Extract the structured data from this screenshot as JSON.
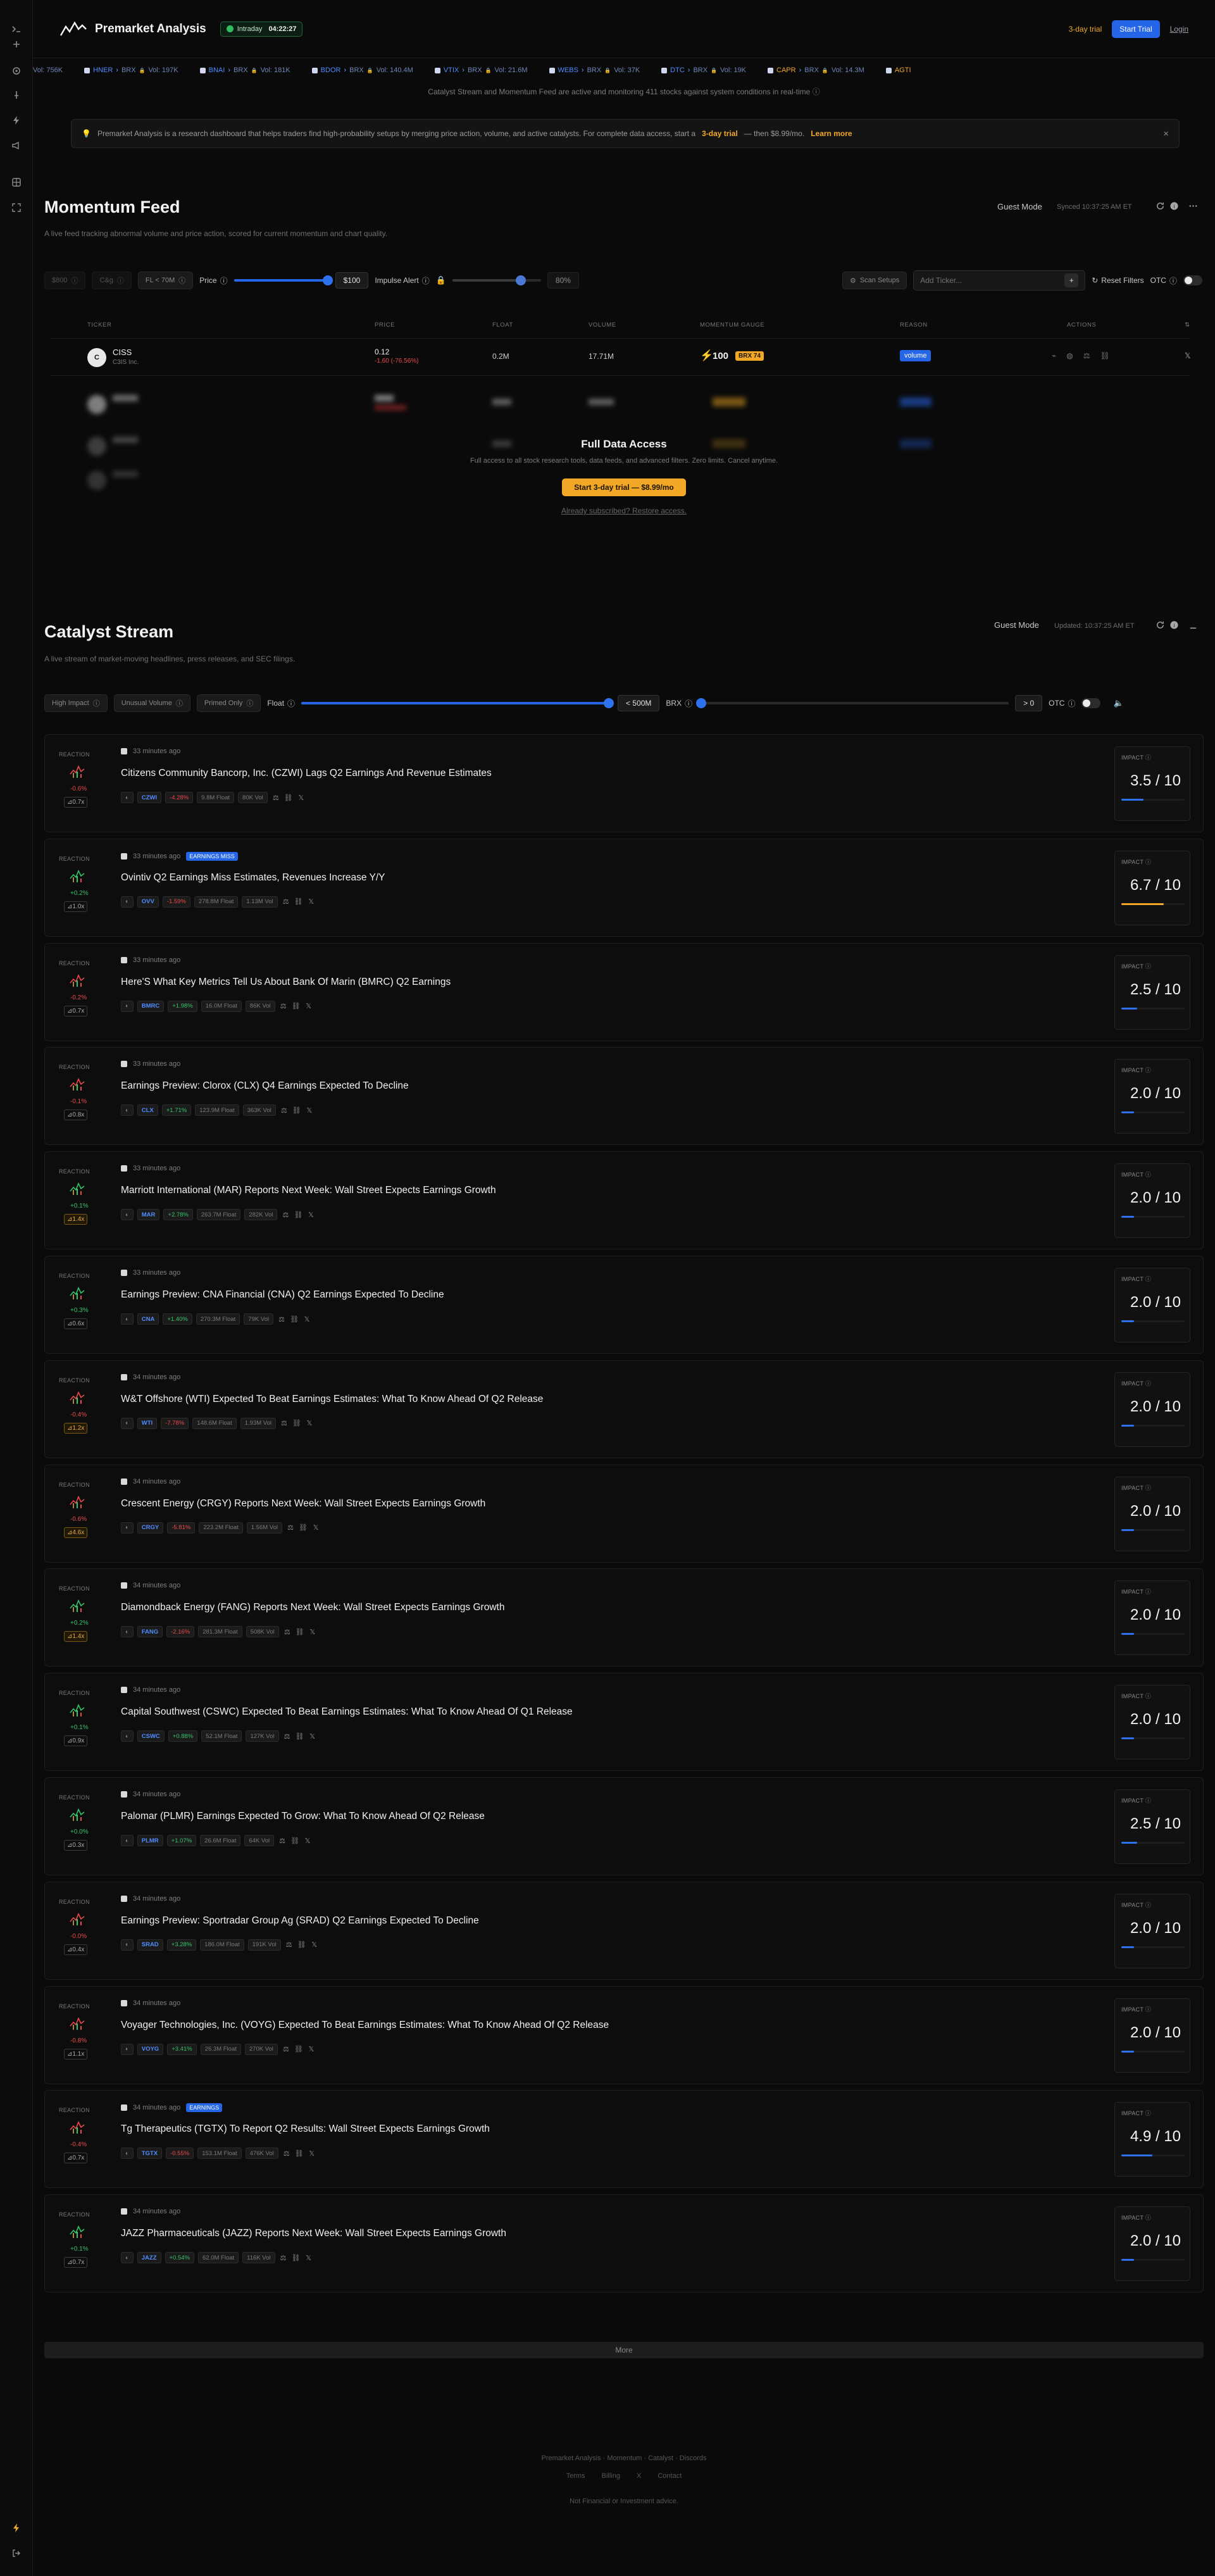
{
  "app": {
    "name": "Premarket Analysis"
  },
  "market_status": {
    "label": "Intraday",
    "time": "04:22:27"
  },
  "header": {
    "trial_text": "3-day trial",
    "start_trial": "Start Trial",
    "login": "Login"
  },
  "ticker_tape": [
    {
      "symbol": "",
      "text": "Vol: 756K"
    },
    {
      "symbol": "HNER",
      "text": "BRX",
      "vol": "Vol: 197K"
    },
    {
      "symbol": "BNAI",
      "text": "BRX",
      "vol": "Vol: 181K"
    },
    {
      "symbol": "BDOR",
      "text": "BRX",
      "vol": "Vol: 140.4M"
    },
    {
      "symbol": "VTIX",
      "text": "BRX",
      "vol": "Vol: 21.6M"
    },
    {
      "symbol": "WEBS",
      "text": "BRX",
      "vol": "Vol: 37K"
    },
    {
      "symbol": "DTC",
      "text": "BRX",
      "vol": "Vol: 19K"
    },
    {
      "symbol": "CAPR",
      "text": "BRX",
      "vol": "Vol: 14.3M",
      "orange": true
    },
    {
      "symbol": "AGTI",
      "text": "",
      "vol": "",
      "orange": true
    }
  ],
  "system_note": "Catalyst Stream and Momentum Feed are active and monitoring 411 stocks against system conditions in real-time",
  "banner": {
    "text_before": "Premarket Analysis is a research dashboard that helps traders find high-probability setups by merging price action, volume, and active catalysts. For complete data access, start a",
    "trial": "3-day trial",
    "text_after": "— then $8.99/mo.",
    "link": "Learn more",
    "close": "×"
  },
  "momentum": {
    "title": "Momentum Feed",
    "subtitle": "A live feed tracking abnormal volume and price action, scored for current momentum and chart quality.",
    "mode": "Guest Mode",
    "synced": "Synced 10:37:25 AM ET",
    "filters": {
      "chip_a": "$800",
      "chip_b": "C&g",
      "chip_c": "FL < 70M",
      "price_label": "Price",
      "price_value": "$100",
      "impulse_label": "Impulse Alert",
      "impulse_value": "80%",
      "scan_setups": "Scan Setups",
      "add_ticker_placeholder": "Add Ticker...",
      "reset": "Reset Filters",
      "otc": "OTC"
    },
    "columns": [
      "TICKER",
      "PRICE",
      "FLOAT",
      "VOLUME",
      "MOMENTUM GAUGE",
      "REASON",
      "ACTIONS"
    ],
    "row": {
      "ticker": "CISS",
      "subname": "C3IS Inc.",
      "price": "0.12",
      "change": "-1.60 (-76.56%)",
      "float": "0.2M",
      "volume": "17.71M",
      "gauge": "100",
      "badge": "BRX 74",
      "reason": "volume"
    },
    "overlay": {
      "title": "Full Data Access",
      "sub": "Full access to all stock research tools, data feeds, and advanced filters. Zero limits. Cancel anytime.",
      "button": "Start 3-day trial — $8.99/mo",
      "link": "Already subscribed? Restore access."
    }
  },
  "catalyst": {
    "title": "Catalyst Stream",
    "subtitle": "A live stream of market-moving headlines, press releases, and SEC filings.",
    "mode": "Guest Mode",
    "updated": "Updated: 10:37:25 AM ET",
    "filters": {
      "high_impact": "High Impact",
      "unusual_volume": "Unusual Volume",
      "primed_only": "Primed Only",
      "float_label": "Float",
      "float_value": "< 500M",
      "brx_label": "BRX",
      "brx_value": "> 0",
      "otc": "OTC"
    },
    "reaction_label": "REACTION",
    "impact_label": "IMPACT",
    "items": [
      {
        "time": "33 minutes ago",
        "tag": "",
        "title": "Citizens Community Bancorp, Inc. (CZWI) Lags Q2 Earnings And Revenue Estimates",
        "symbol": "CZWI",
        "chg": "-4.28%",
        "up": false,
        "float": "9.8M Float",
        "vol": "80K Vol",
        "reaction": "-0.6%",
        "rup": false,
        "rvol": "0.7x",
        "warn": false,
        "impact": "3.5 / 10",
        "impact_frac": 0.35,
        "accent": "#2f72f0"
      },
      {
        "time": "33 minutes ago",
        "tag": "EARNINGS MISS",
        "title": "Ovintiv Q2 Earnings Miss Estimates, Revenues Increase Y/Y",
        "symbol": "OVV",
        "chg": "-1.59%",
        "up": false,
        "float": "278.8M Float",
        "vol": "1.13M Vol",
        "reaction": "+0.2%",
        "rup": true,
        "rvol": "1.0x",
        "warn": false,
        "impact": "6.7 / 10",
        "impact_frac": 0.67,
        "accent": "#f2a726"
      },
      {
        "time": "33 minutes ago",
        "tag": "",
        "title": "Here'S What Key Metrics Tell Us About Bank Of Marin (BMRC) Q2 Earnings",
        "symbol": "BMRC",
        "chg": "+1.98%",
        "up": true,
        "float": "16.0M Float",
        "vol": "86K Vol",
        "reaction": "-0.2%",
        "rup": false,
        "rvol": "0.7x",
        "warn": false,
        "impact": "2.5 / 10",
        "impact_frac": 0.25,
        "accent": "#2f72f0"
      },
      {
        "time": "33 minutes ago",
        "tag": "",
        "title": "Earnings Preview: Clorox (CLX) Q4 Earnings Expected To Decline",
        "symbol": "CLX",
        "chg": "+1.71%",
        "up": true,
        "float": "123.9M Float",
        "vol": "363K Vol",
        "reaction": "-0.1%",
        "rup": false,
        "rvol": "0.8x",
        "warn": false,
        "impact": "2.0 / 10",
        "impact_frac": 0.2,
        "accent": "#2f72f0"
      },
      {
        "time": "33 minutes ago",
        "tag": "",
        "title": "Marriott International (MAR) Reports Next Week: Wall Street Expects Earnings Growth",
        "symbol": "MAR",
        "chg": "+2.78%",
        "up": true,
        "float": "263.7M Float",
        "vol": "282K Vol",
        "reaction": "+0.1%",
        "rup": true,
        "rvol": "1.4x",
        "warn": true,
        "impact": "2.0 / 10",
        "impact_frac": 0.2,
        "accent": "#2f72f0"
      },
      {
        "time": "33 minutes ago",
        "tag": "",
        "title": "Earnings Preview: CNA Financial (CNA) Q2 Earnings Expected To Decline",
        "symbol": "CNA",
        "chg": "+1.40%",
        "up": true,
        "float": "270.3M Float",
        "vol": "79K Vol",
        "reaction": "+0.3%",
        "rup": true,
        "rvol": "0.6x",
        "warn": false,
        "impact": "2.0 / 10",
        "impact_frac": 0.2,
        "accent": "#2f72f0"
      },
      {
        "time": "34 minutes ago",
        "tag": "",
        "title": "W&T Offshore (WTI) Expected To Beat Earnings Estimates: What To Know Ahead Of Q2 Release",
        "symbol": "WTI",
        "chg": "-7.78%",
        "up": false,
        "float": "148.6M Float",
        "vol": "1.93M Vol",
        "reaction": "-0.4%",
        "rup": false,
        "rvol": "1.2x",
        "warn": true,
        "impact": "2.0 / 10",
        "impact_frac": 0.2,
        "accent": "#2f72f0"
      },
      {
        "time": "34 minutes ago",
        "tag": "",
        "title": "Crescent Energy (CRGY) Reports Next Week: Wall Street Expects Earnings Growth",
        "symbol": "CRGY",
        "chg": "-5.81%",
        "up": false,
        "float": "223.2M Float",
        "vol": "1.56M Vol",
        "reaction": "-0.6%",
        "rup": false,
        "rvol": "4.6x",
        "warn": true,
        "impact": "2.0 / 10",
        "impact_frac": 0.2,
        "accent": "#2f72f0"
      },
      {
        "time": "34 minutes ago",
        "tag": "",
        "title": "Diamondback Energy (FANG) Reports Next Week: Wall Street Expects Earnings Growth",
        "symbol": "FANG",
        "chg": "-2.16%",
        "up": false,
        "float": "281.3M Float",
        "vol": "508K Vol",
        "reaction": "+0.2%",
        "rup": true,
        "rvol": "1.4x",
        "warn": true,
        "impact": "2.0 / 10",
        "impact_frac": 0.2,
        "accent": "#2f72f0"
      },
      {
        "time": "34 minutes ago",
        "tag": "",
        "title": "Capital Southwest (CSWC) Expected To Beat Earnings Estimates: What To Know Ahead Of Q1 Release",
        "symbol": "CSWC",
        "chg": "+0.88%",
        "up": true,
        "float": "52.1M Float",
        "vol": "127K Vol",
        "reaction": "+0.1%",
        "rup": true,
        "rvol": "0.9x",
        "warn": false,
        "impact": "2.0 / 10",
        "impact_frac": 0.2,
        "accent": "#2f72f0"
      },
      {
        "time": "34 minutes ago",
        "tag": "",
        "title": "Palomar (PLMR) Earnings Expected To Grow: What To Know Ahead Of Q2 Release",
        "symbol": "PLMR",
        "chg": "+1.07%",
        "up": true,
        "float": "26.6M Float",
        "vol": "64K Vol",
        "reaction": "+0.0%",
        "rup": true,
        "rvol": "0.3x",
        "warn": false,
        "impact": "2.5 / 10",
        "impact_frac": 0.25,
        "accent": "#2f72f0"
      },
      {
        "time": "34 minutes ago",
        "tag": "",
        "title": "Earnings Preview: Sportradar Group Ag (SRAD) Q2 Earnings Expected To Decline",
        "symbol": "SRAD",
        "chg": "+3.28%",
        "up": true,
        "float": "186.0M Float",
        "vol": "191K Vol",
        "reaction": "-0.0%",
        "rup": false,
        "rvol": "0.4x",
        "warn": false,
        "impact": "2.0 / 10",
        "impact_frac": 0.2,
        "accent": "#2f72f0"
      },
      {
        "time": "34 minutes ago",
        "tag": "",
        "title": "Voyager Technologies, Inc. (VOYG) Expected To Beat Earnings Estimates: What To Know Ahead Of Q2 Release",
        "symbol": "VOYG",
        "chg": "+3.41%",
        "up": true,
        "float": "26.3M Float",
        "vol": "270K Vol",
        "reaction": "-0.8%",
        "rup": false,
        "rvol": "1.1x",
        "warn": false,
        "impact": "2.0 / 10",
        "impact_frac": 0.2,
        "accent": "#2f72f0"
      },
      {
        "time": "34 minutes ago",
        "tag": "EARNINGS",
        "title": "Tg Therapeutics (TGTX) To Report Q2 Results: Wall Street Expects Earnings Growth",
        "symbol": "TGTX",
        "chg": "-0.55%",
        "up": false,
        "float": "153.1M Float",
        "vol": "476K Vol",
        "reaction": "-0.4%",
        "rup": false,
        "rvol": "0.7x",
        "warn": false,
        "impact": "4.9 / 10",
        "impact_frac": 0.49,
        "accent": "#2f72f0"
      },
      {
        "time": "34 minutes ago",
        "tag": "",
        "title": "JAZZ Pharmaceuticals (JAZZ) Reports Next Week: Wall Street Expects Earnings Growth",
        "symbol": "JAZZ",
        "chg": "+0.54%",
        "up": true,
        "float": "62.0M Float",
        "vol": "116K Vol",
        "reaction": "+0.1%",
        "rup": true,
        "rvol": "0.7x",
        "warn": false,
        "impact": "2.0 / 10",
        "impact_frac": 0.2,
        "accent": "#2f72f0"
      }
    ],
    "more": "More"
  },
  "footer": {
    "line1": "Premarket Analysis · Momentum · Catalyst · Discords",
    "links": [
      "Terms",
      "Billing",
      "X",
      "Contact"
    ],
    "line3": "Not Financial or Investment advice."
  }
}
